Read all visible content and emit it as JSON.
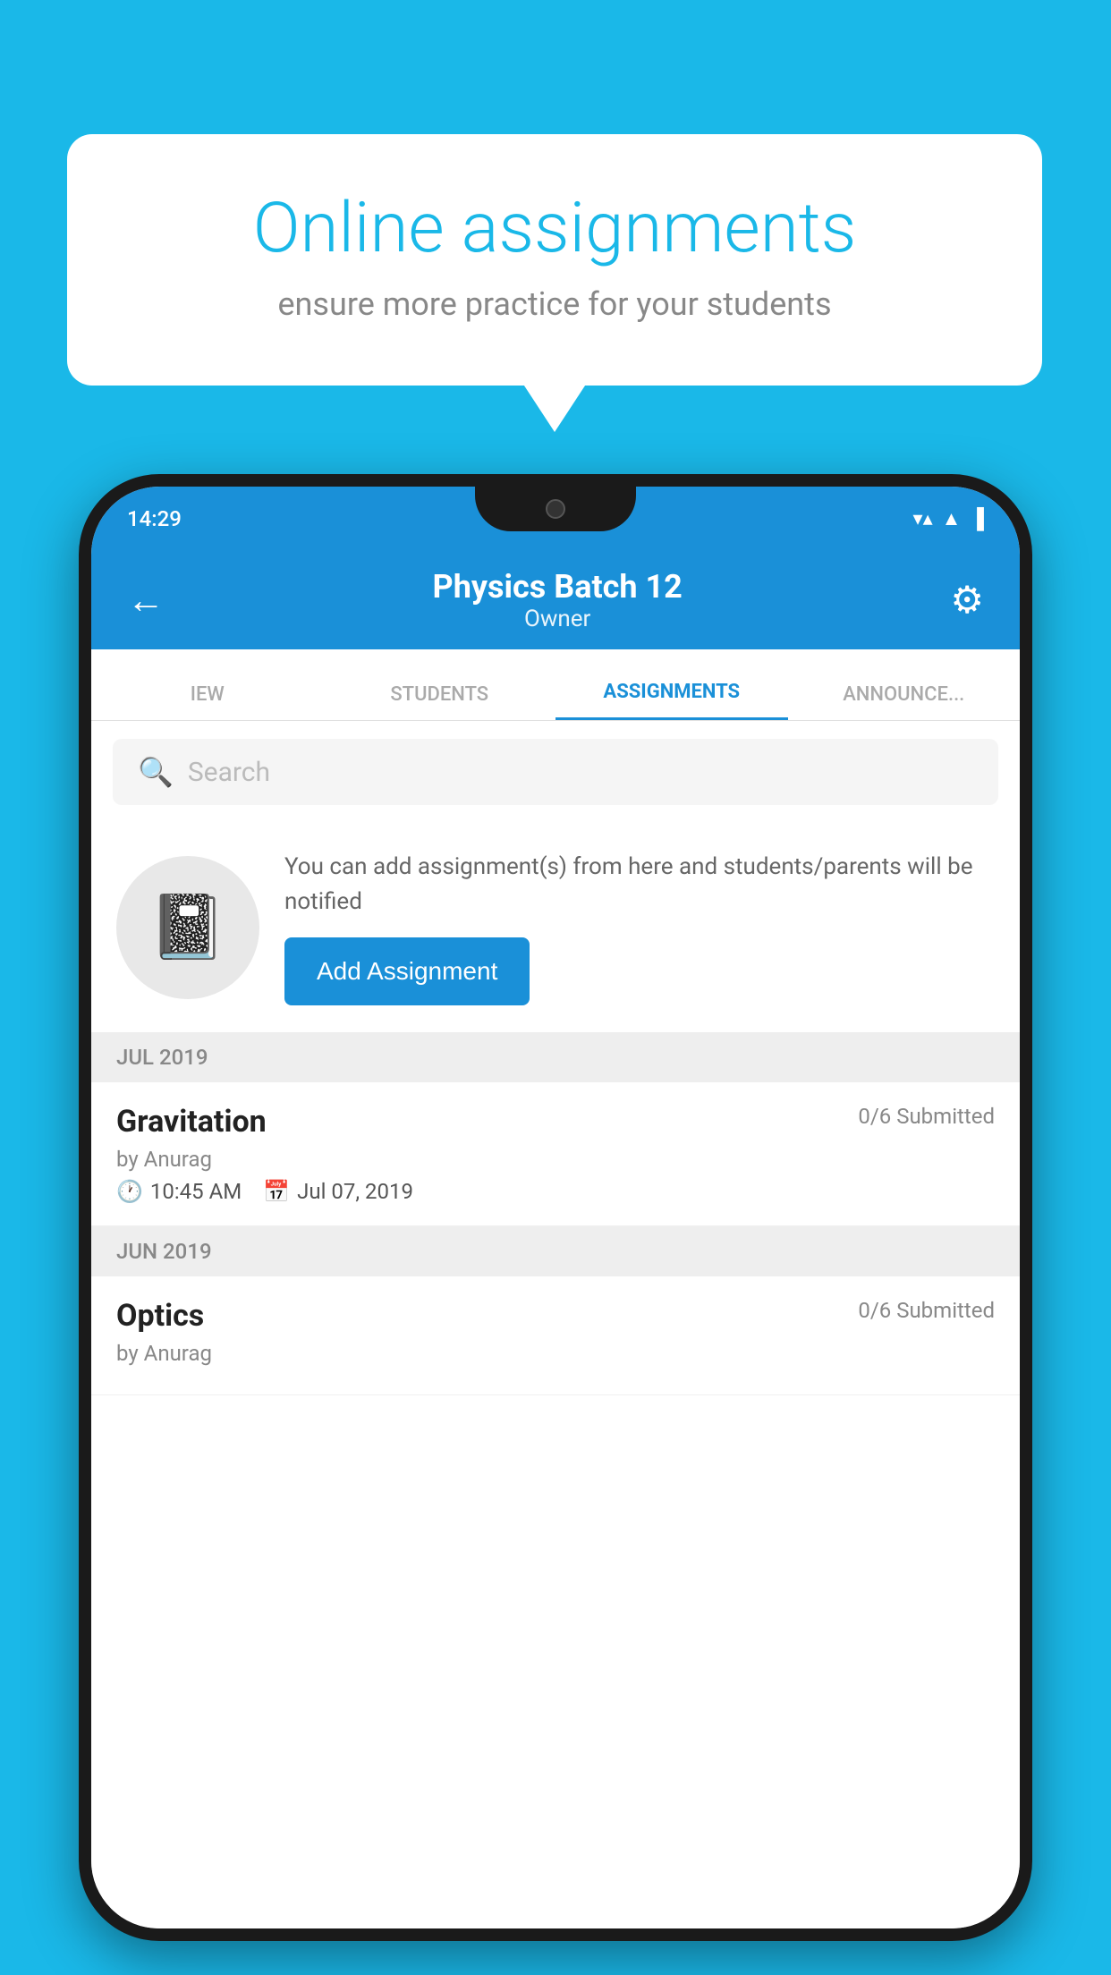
{
  "background_color": "#1ab8e8",
  "speech_bubble": {
    "title": "Online assignments",
    "subtitle": "ensure more practice for your students"
  },
  "phone": {
    "status_bar": {
      "time": "14:29",
      "wifi": "▼▲",
      "signal": "▲",
      "battery": "▐"
    },
    "header": {
      "back_label": "←",
      "title": "Physics Batch 12",
      "subtitle": "Owner",
      "gear_label": "⚙"
    },
    "tabs": [
      {
        "label": "IEW",
        "active": false
      },
      {
        "label": "STUDENTS",
        "active": false
      },
      {
        "label": "ASSIGNMENTS",
        "active": true
      },
      {
        "label": "ANNOUNCEMENTS",
        "active": false
      }
    ],
    "search": {
      "placeholder": "Search"
    },
    "promo": {
      "description": "You can add assignment(s) from here and students/parents will be notified",
      "button_label": "Add Assignment"
    },
    "sections": [
      {
        "title": "JUL 2019",
        "assignments": [
          {
            "name": "Gravitation",
            "submitted": "0/6 Submitted",
            "by": "by Anurag",
            "time": "10:45 AM",
            "date": "Jul 07, 2019"
          }
        ]
      },
      {
        "title": "JUN 2019",
        "assignments": [
          {
            "name": "Optics",
            "submitted": "0/6 Submitted",
            "by": "by Anurag",
            "time": "",
            "date": ""
          }
        ]
      }
    ]
  }
}
